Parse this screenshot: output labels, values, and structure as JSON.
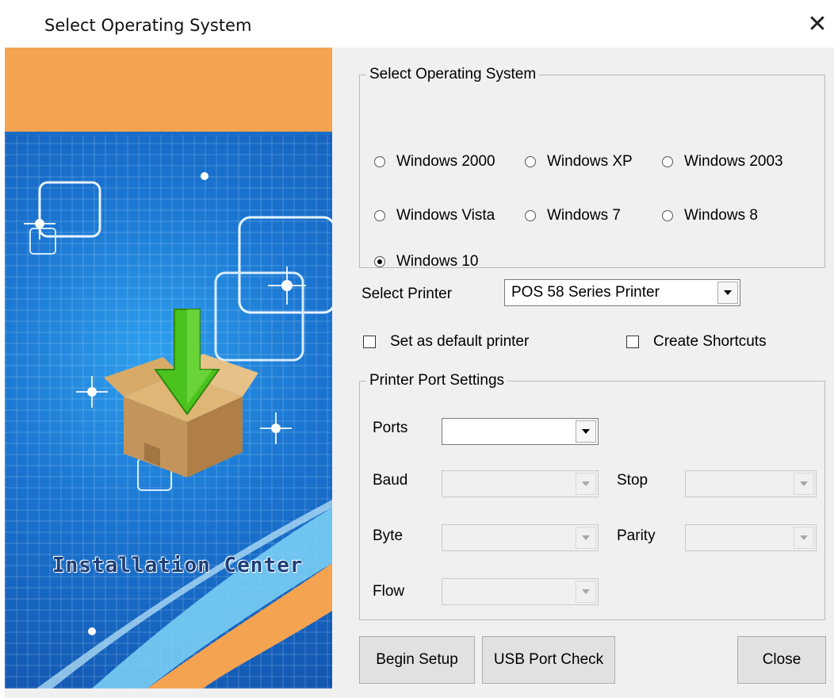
{
  "window": {
    "title": "Select Operating System",
    "close_icon": "close-icon"
  },
  "banner": {
    "text": "Installation Center",
    "accent_color": "#f4a351",
    "background_color": "#1b6dc6"
  },
  "os_group": {
    "legend": "Select Operating System",
    "options": [
      {
        "label": "Windows 2000",
        "selected": false
      },
      {
        "label": "Windows XP",
        "selected": false
      },
      {
        "label": "Windows 2003",
        "selected": false
      },
      {
        "label": "Windows Vista",
        "selected": false
      },
      {
        "label": "Windows 7",
        "selected": false
      },
      {
        "label": "Windows 8",
        "selected": false
      },
      {
        "label": "Windows 10",
        "selected": true
      }
    ]
  },
  "printer": {
    "label": "Select Printer",
    "value": "POS 58 Series Printer"
  },
  "options": {
    "default_printer_label": "Set as default printer",
    "default_printer_checked": false,
    "shortcuts_label": "Create Shortcuts",
    "shortcuts_checked": false
  },
  "port_group": {
    "legend": "Printer Port Settings",
    "ports_label": "Ports",
    "ports_value": "",
    "baud_label": "Baud",
    "baud_value": "",
    "stop_label": "Stop",
    "stop_value": "",
    "byte_label": "Byte",
    "byte_value": "",
    "parity_label": "Parity",
    "parity_value": "",
    "flow_label": "Flow",
    "flow_value": ""
  },
  "buttons": {
    "begin": "Begin Setup",
    "usb": "USB Port Check",
    "close": "Close"
  }
}
